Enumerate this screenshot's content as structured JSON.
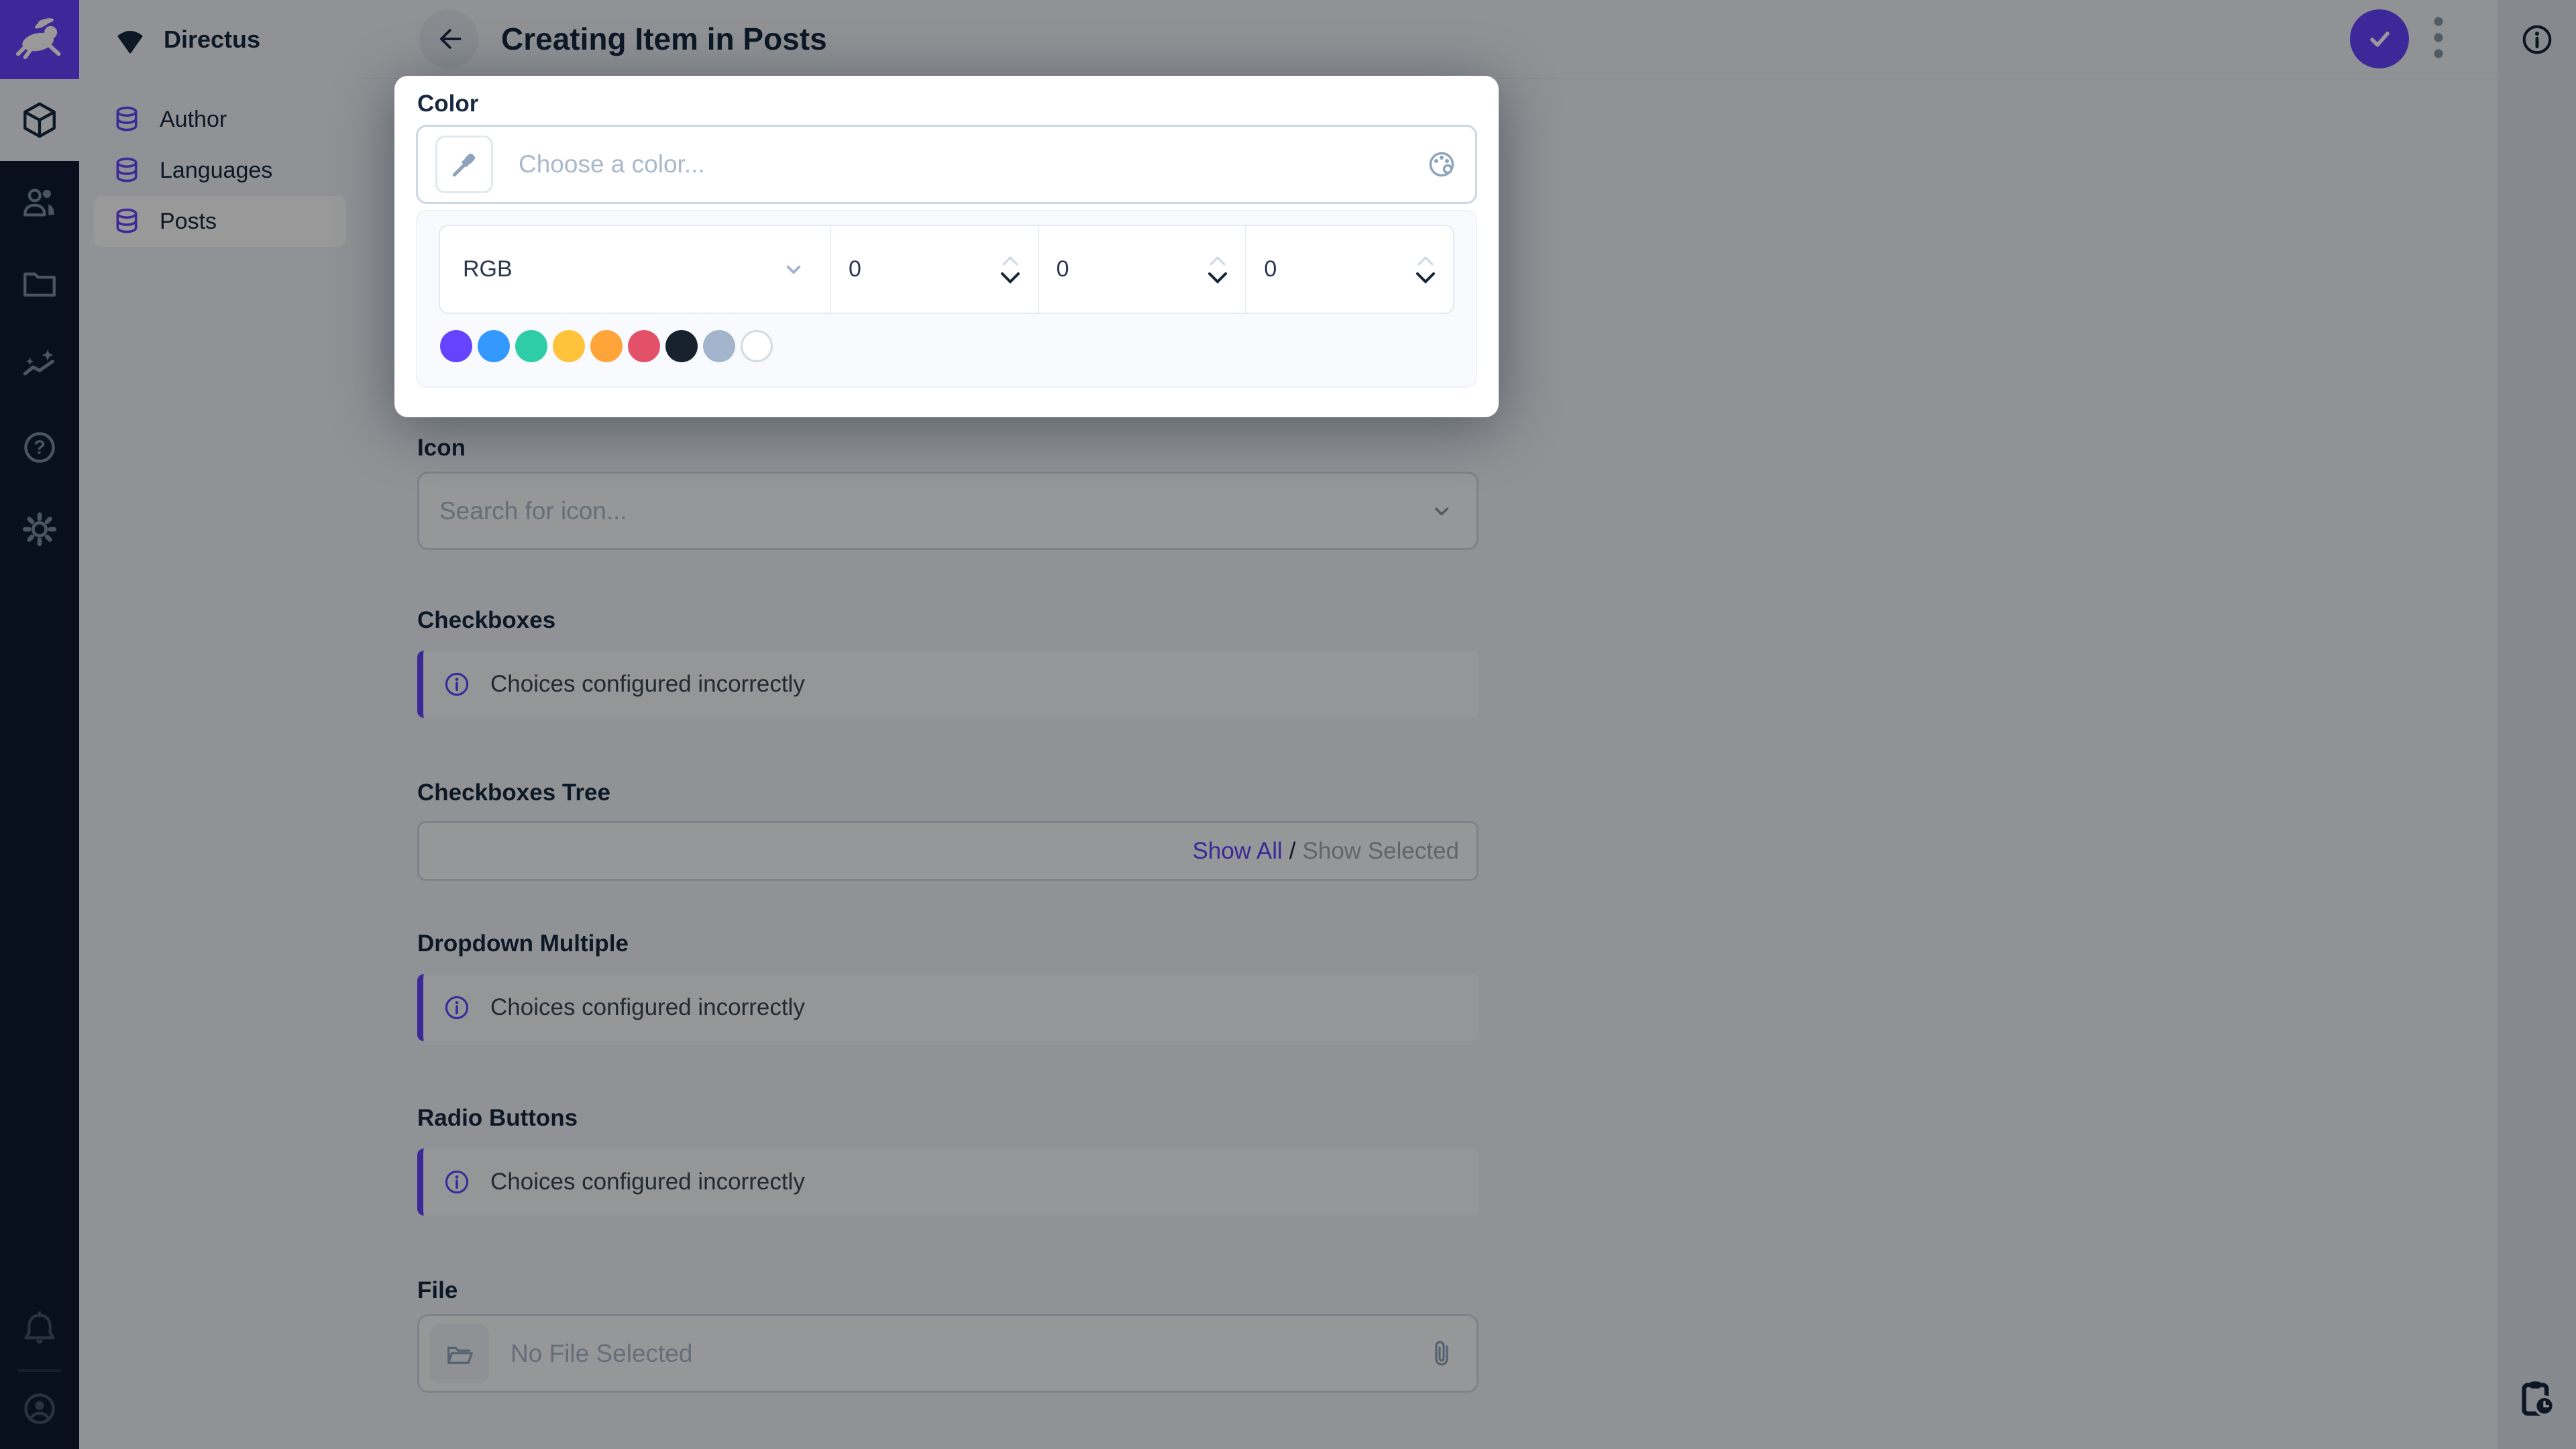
{
  "app": {
    "project_name": "Directus"
  },
  "module_bar": {
    "icons": [
      "content-module",
      "users-module",
      "files-module",
      "insights-module",
      "docs-module",
      "settings-module",
      "notifications",
      "account"
    ]
  },
  "nav": {
    "items": [
      {
        "label": "Author"
      },
      {
        "label": "Languages"
      },
      {
        "label": "Posts",
        "active": true
      }
    ]
  },
  "header": {
    "title": "Creating Item in Posts",
    "save_icon": "check",
    "menu_icon": "kebab-vertical"
  },
  "right_bar": {
    "top_icon": "info",
    "bottom_icon": "pending-actions"
  },
  "color_picker": {
    "label": "Color",
    "placeholder": "Choose a color...",
    "mode": "RGB",
    "r": "0",
    "g": "0",
    "b": "0",
    "swatches": [
      "#6644FF",
      "#3399FF",
      "#2ECDA7",
      "#FFC23B",
      "#FFA439",
      "#E35169",
      "#18222F",
      "#A2B5CD",
      "#FFFFFF"
    ]
  },
  "fields": {
    "icon": {
      "label": "Icon",
      "placeholder": "Search for icon..."
    },
    "checkboxes": {
      "label": "Checkboxes",
      "notice": "Choices configured incorrectly"
    },
    "checkboxes_tree": {
      "label": "Checkboxes Tree",
      "show_all": "Show All",
      "separator": "/",
      "show_selected": "Show Selected"
    },
    "dropdown_multiple": {
      "label": "Dropdown Multiple",
      "notice": "Choices configured incorrectly"
    },
    "radio_buttons": {
      "label": "Radio Buttons",
      "notice": "Choices configured incorrectly"
    },
    "file": {
      "label": "File",
      "placeholder": "No File Selected"
    }
  },
  "colors": {
    "accent": "#6644FF",
    "module_bar_bg": "#0D1C2F",
    "page_bg": "#F0F4F9",
    "text_dark": "#172940"
  }
}
